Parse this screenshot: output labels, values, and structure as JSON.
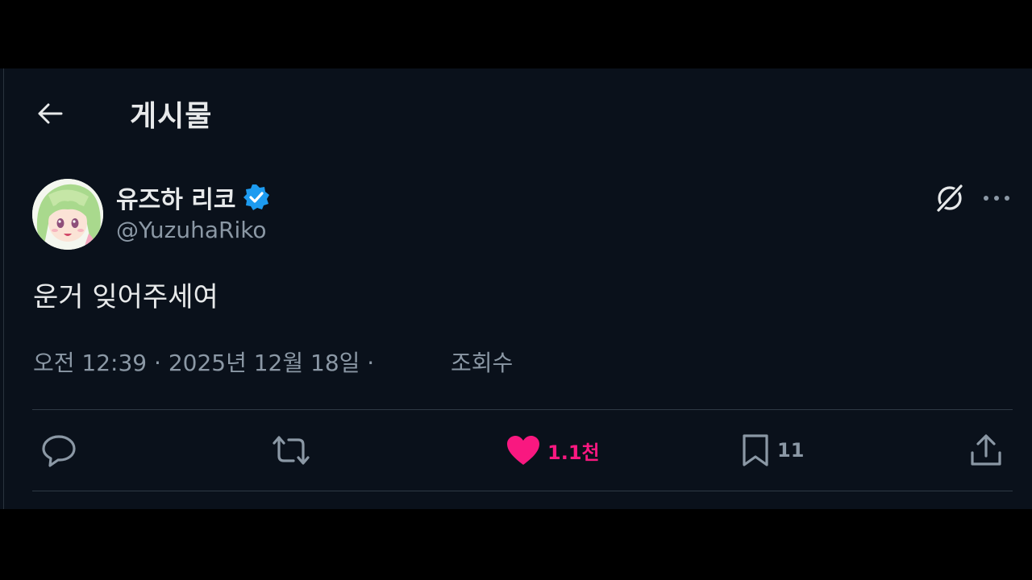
{
  "header": {
    "title": "게시물"
  },
  "author": {
    "display_name": "유즈하 리코",
    "handle": "@YuzuhaRiko",
    "verified": true
  },
  "post": {
    "text": "운거 잊어주세여",
    "time": "오전 12:39 · 2025년 12월 18일 ·",
    "views_label": "조회수"
  },
  "actions": {
    "likes": "1.1천",
    "bookmarks": "11"
  },
  "colors": {
    "background": "#0a111b",
    "text_primary": "#e7e9ea",
    "text_secondary": "#8b98a5",
    "like_accent": "#f91880",
    "verified_badge": "#1d9bf0"
  }
}
